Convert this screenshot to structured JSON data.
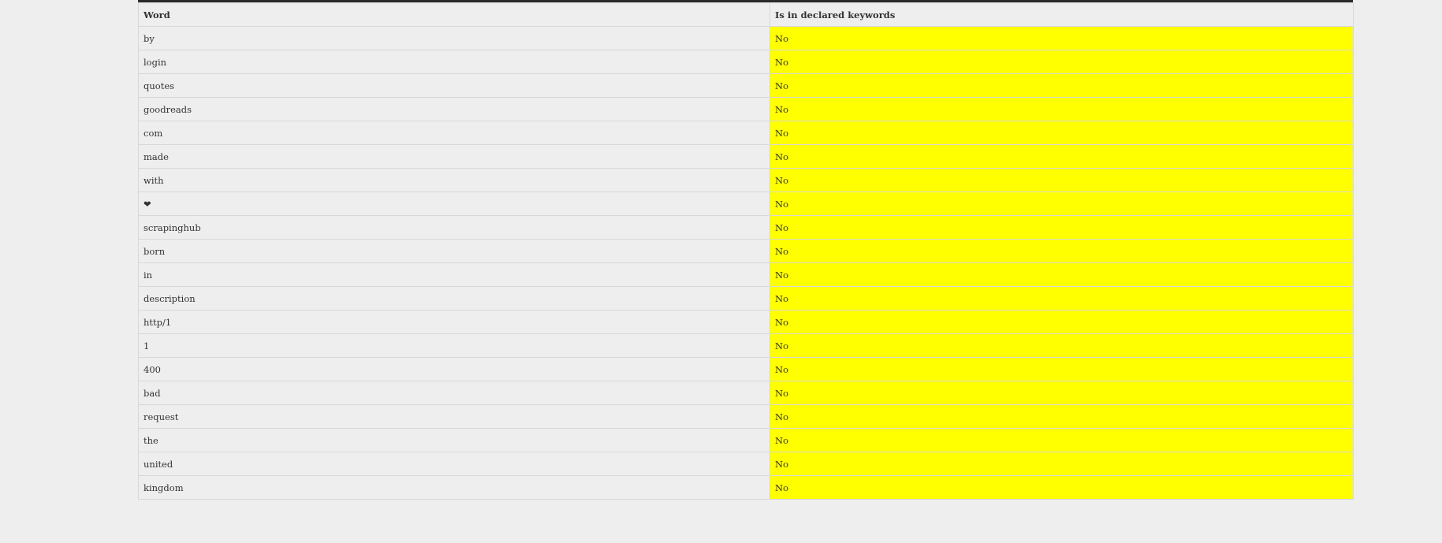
{
  "colors": {
    "page_background": "#eeeeee",
    "highlight": "#ffff00",
    "top_bar": "#2a2a2a"
  },
  "table": {
    "headers": {
      "word": "Word",
      "declared": "Is in declared keywords"
    },
    "rows": [
      {
        "word": "by",
        "declared": "No"
      },
      {
        "word": "login",
        "declared": "No"
      },
      {
        "word": "quotes",
        "declared": "No"
      },
      {
        "word": "goodreads",
        "declared": "No"
      },
      {
        "word": "com",
        "declared": "No"
      },
      {
        "word": "made",
        "declared": "No"
      },
      {
        "word": "with",
        "declared": "No"
      },
      {
        "word": "❤",
        "declared": "No"
      },
      {
        "word": "scrapinghub",
        "declared": "No"
      },
      {
        "word": "born",
        "declared": "No"
      },
      {
        "word": "in",
        "declared": "No"
      },
      {
        "word": "description",
        "declared": "No"
      },
      {
        "word": "http/1",
        "declared": "No"
      },
      {
        "word": "1",
        "declared": "No"
      },
      {
        "word": "400",
        "declared": "No"
      },
      {
        "word": "bad",
        "declared": "No"
      },
      {
        "word": "request",
        "declared": "No"
      },
      {
        "word": "the",
        "declared": "No"
      },
      {
        "word": "united",
        "declared": "No"
      },
      {
        "word": "kingdom",
        "declared": "No"
      }
    ]
  }
}
